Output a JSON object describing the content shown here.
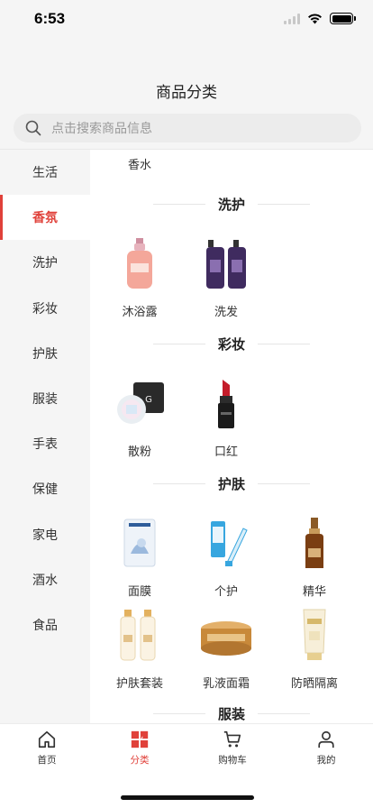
{
  "status": {
    "time": "6:53"
  },
  "header": {
    "title": "商品分类"
  },
  "search": {
    "placeholder": "点击搜索商品信息"
  },
  "sidebar": {
    "items": [
      {
        "label": "生活",
        "active": false
      },
      {
        "label": "香氛",
        "active": true
      },
      {
        "label": "洗护",
        "active": false
      },
      {
        "label": "彩妆",
        "active": false
      },
      {
        "label": "护肤",
        "active": false
      },
      {
        "label": "服装",
        "active": false
      },
      {
        "label": "手表",
        "active": false
      },
      {
        "label": "保健",
        "active": false
      },
      {
        "label": "家电",
        "active": false
      },
      {
        "label": "酒水",
        "active": false
      },
      {
        "label": "食品",
        "active": false
      }
    ]
  },
  "content": {
    "top_label": "香水",
    "sections": [
      {
        "title": "洗护",
        "products": [
          {
            "name": "沐浴露",
            "icon": "body-wash-icon"
          },
          {
            "name": "洗发",
            "icon": "shampoo-icon"
          }
        ]
      },
      {
        "title": "彩妆",
        "products": [
          {
            "name": "散粉",
            "icon": "loose-powder-icon"
          },
          {
            "name": "口红",
            "icon": "lipstick-icon"
          }
        ]
      },
      {
        "title": "护肤",
        "products": [
          {
            "name": "面膜",
            "icon": "face-mask-icon"
          },
          {
            "name": "个护",
            "icon": "personal-care-icon"
          },
          {
            "name": "精华",
            "icon": "serum-icon"
          },
          {
            "name": "护肤套装",
            "icon": "skincare-set-icon"
          },
          {
            "name": "乳液面霜",
            "icon": "face-cream-icon"
          },
          {
            "name": "防晒隔离",
            "icon": "sunscreen-icon"
          }
        ]
      },
      {
        "title": "服装",
        "products": []
      }
    ]
  },
  "tabbar": {
    "tabs": [
      {
        "label": "首页",
        "icon": "home-icon",
        "active": false
      },
      {
        "label": "分类",
        "icon": "category-icon",
        "active": true
      },
      {
        "label": "购物车",
        "icon": "cart-icon",
        "active": false
      },
      {
        "label": "我的",
        "icon": "user-icon",
        "active": false
      }
    ]
  },
  "colors": {
    "accent": "#e0413a",
    "background": "#f5f5f5"
  }
}
